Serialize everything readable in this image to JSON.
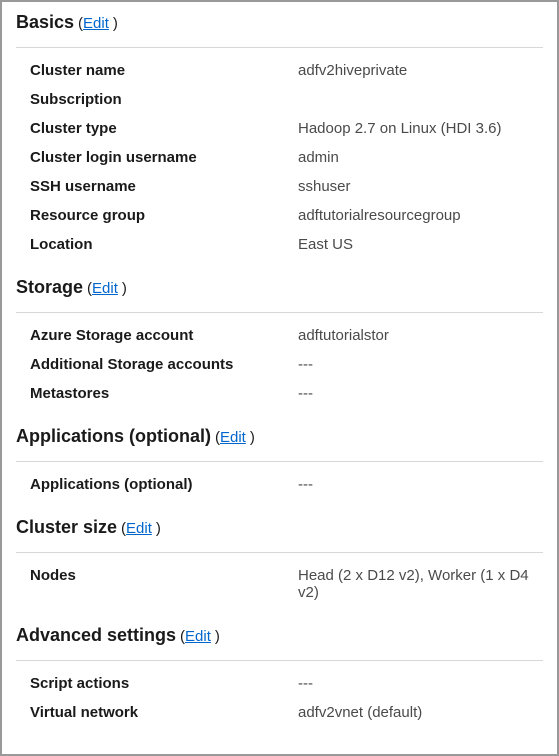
{
  "basics": {
    "title": "Basics",
    "edit": "Edit",
    "rows": {
      "cluster_name_label": "Cluster name",
      "cluster_name_value": "adfv2hiveprivate",
      "subscription_label": "Subscription",
      "subscription_value": "",
      "cluster_type_label": "Cluster type",
      "cluster_type_value": "Hadoop 2.7 on Linux (HDI 3.6)",
      "cluster_login_label": "Cluster login username",
      "cluster_login_value": "admin",
      "ssh_label": "SSH username",
      "ssh_value": "sshuser",
      "rg_label": "Resource group",
      "rg_value": "adftutorialresourcegroup",
      "location_label": "Location",
      "location_value": "East US"
    }
  },
  "storage": {
    "title": "Storage",
    "edit": "Edit",
    "rows": {
      "account_label": "Azure Storage account",
      "account_value": " adftutorialstor",
      "additional_label": "Additional Storage accounts",
      "additional_value": "---",
      "metastores_label": "Metastores",
      "metastores_value": "---"
    }
  },
  "applications": {
    "title": "Applications (optional)",
    "edit": "Edit",
    "rows": {
      "apps_label": "Applications (optional)",
      "apps_value": "---"
    }
  },
  "cluster_size": {
    "title": "Cluster size",
    "edit": "Edit",
    "rows": {
      "nodes_label": "Nodes",
      "nodes_value": "Head (2 x D12 v2), Worker (1 x D4 v2)"
    }
  },
  "advanced": {
    "title": "Advanced settings",
    "edit": "Edit",
    "rows": {
      "script_label": "Script actions",
      "script_value": "---",
      "vnet_label": "Virtual network",
      "vnet_value": "adfv2vnet (default)"
    }
  }
}
